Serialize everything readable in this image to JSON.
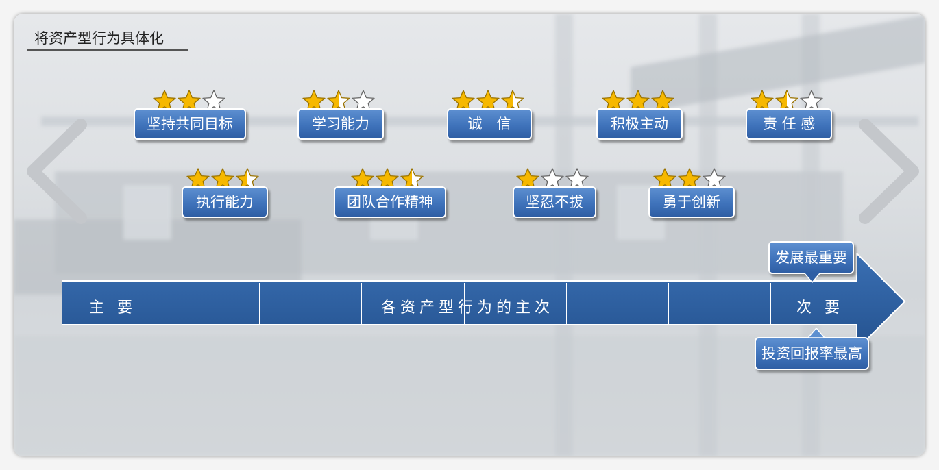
{
  "title": "将资产型行为具体化",
  "icons": {
    "left": "chevron-left-icon",
    "right": "chevron-right-icon",
    "star": "star-icon"
  },
  "colors": {
    "star": "#f6b800",
    "badge": "#3f73bb",
    "arrow": "#2a5c9c"
  },
  "behaviors": [
    {
      "label": "坚持共同目标",
      "stars": 2
    },
    {
      "label": "学习能力",
      "stars": 1.5
    },
    {
      "label": "诚　信",
      "stars": 2.5
    },
    {
      "label": "积极主动",
      "stars": 3
    },
    {
      "label": "责 任 感",
      "stars": 1.5
    },
    {
      "label": "执行能力",
      "stars": 2.5
    },
    {
      "label": "团队合作精神",
      "stars": 2.5
    },
    {
      "label": "坚忍不拔",
      "stars": 1
    },
    {
      "label": "勇于创新",
      "stars": 2
    }
  ],
  "arrow": {
    "left_label": "主  要",
    "center_label": "各资产型行为的主次",
    "right_label": "次  要"
  },
  "callouts": {
    "top": "发展最重要",
    "bottom": "投资回报率最高"
  }
}
